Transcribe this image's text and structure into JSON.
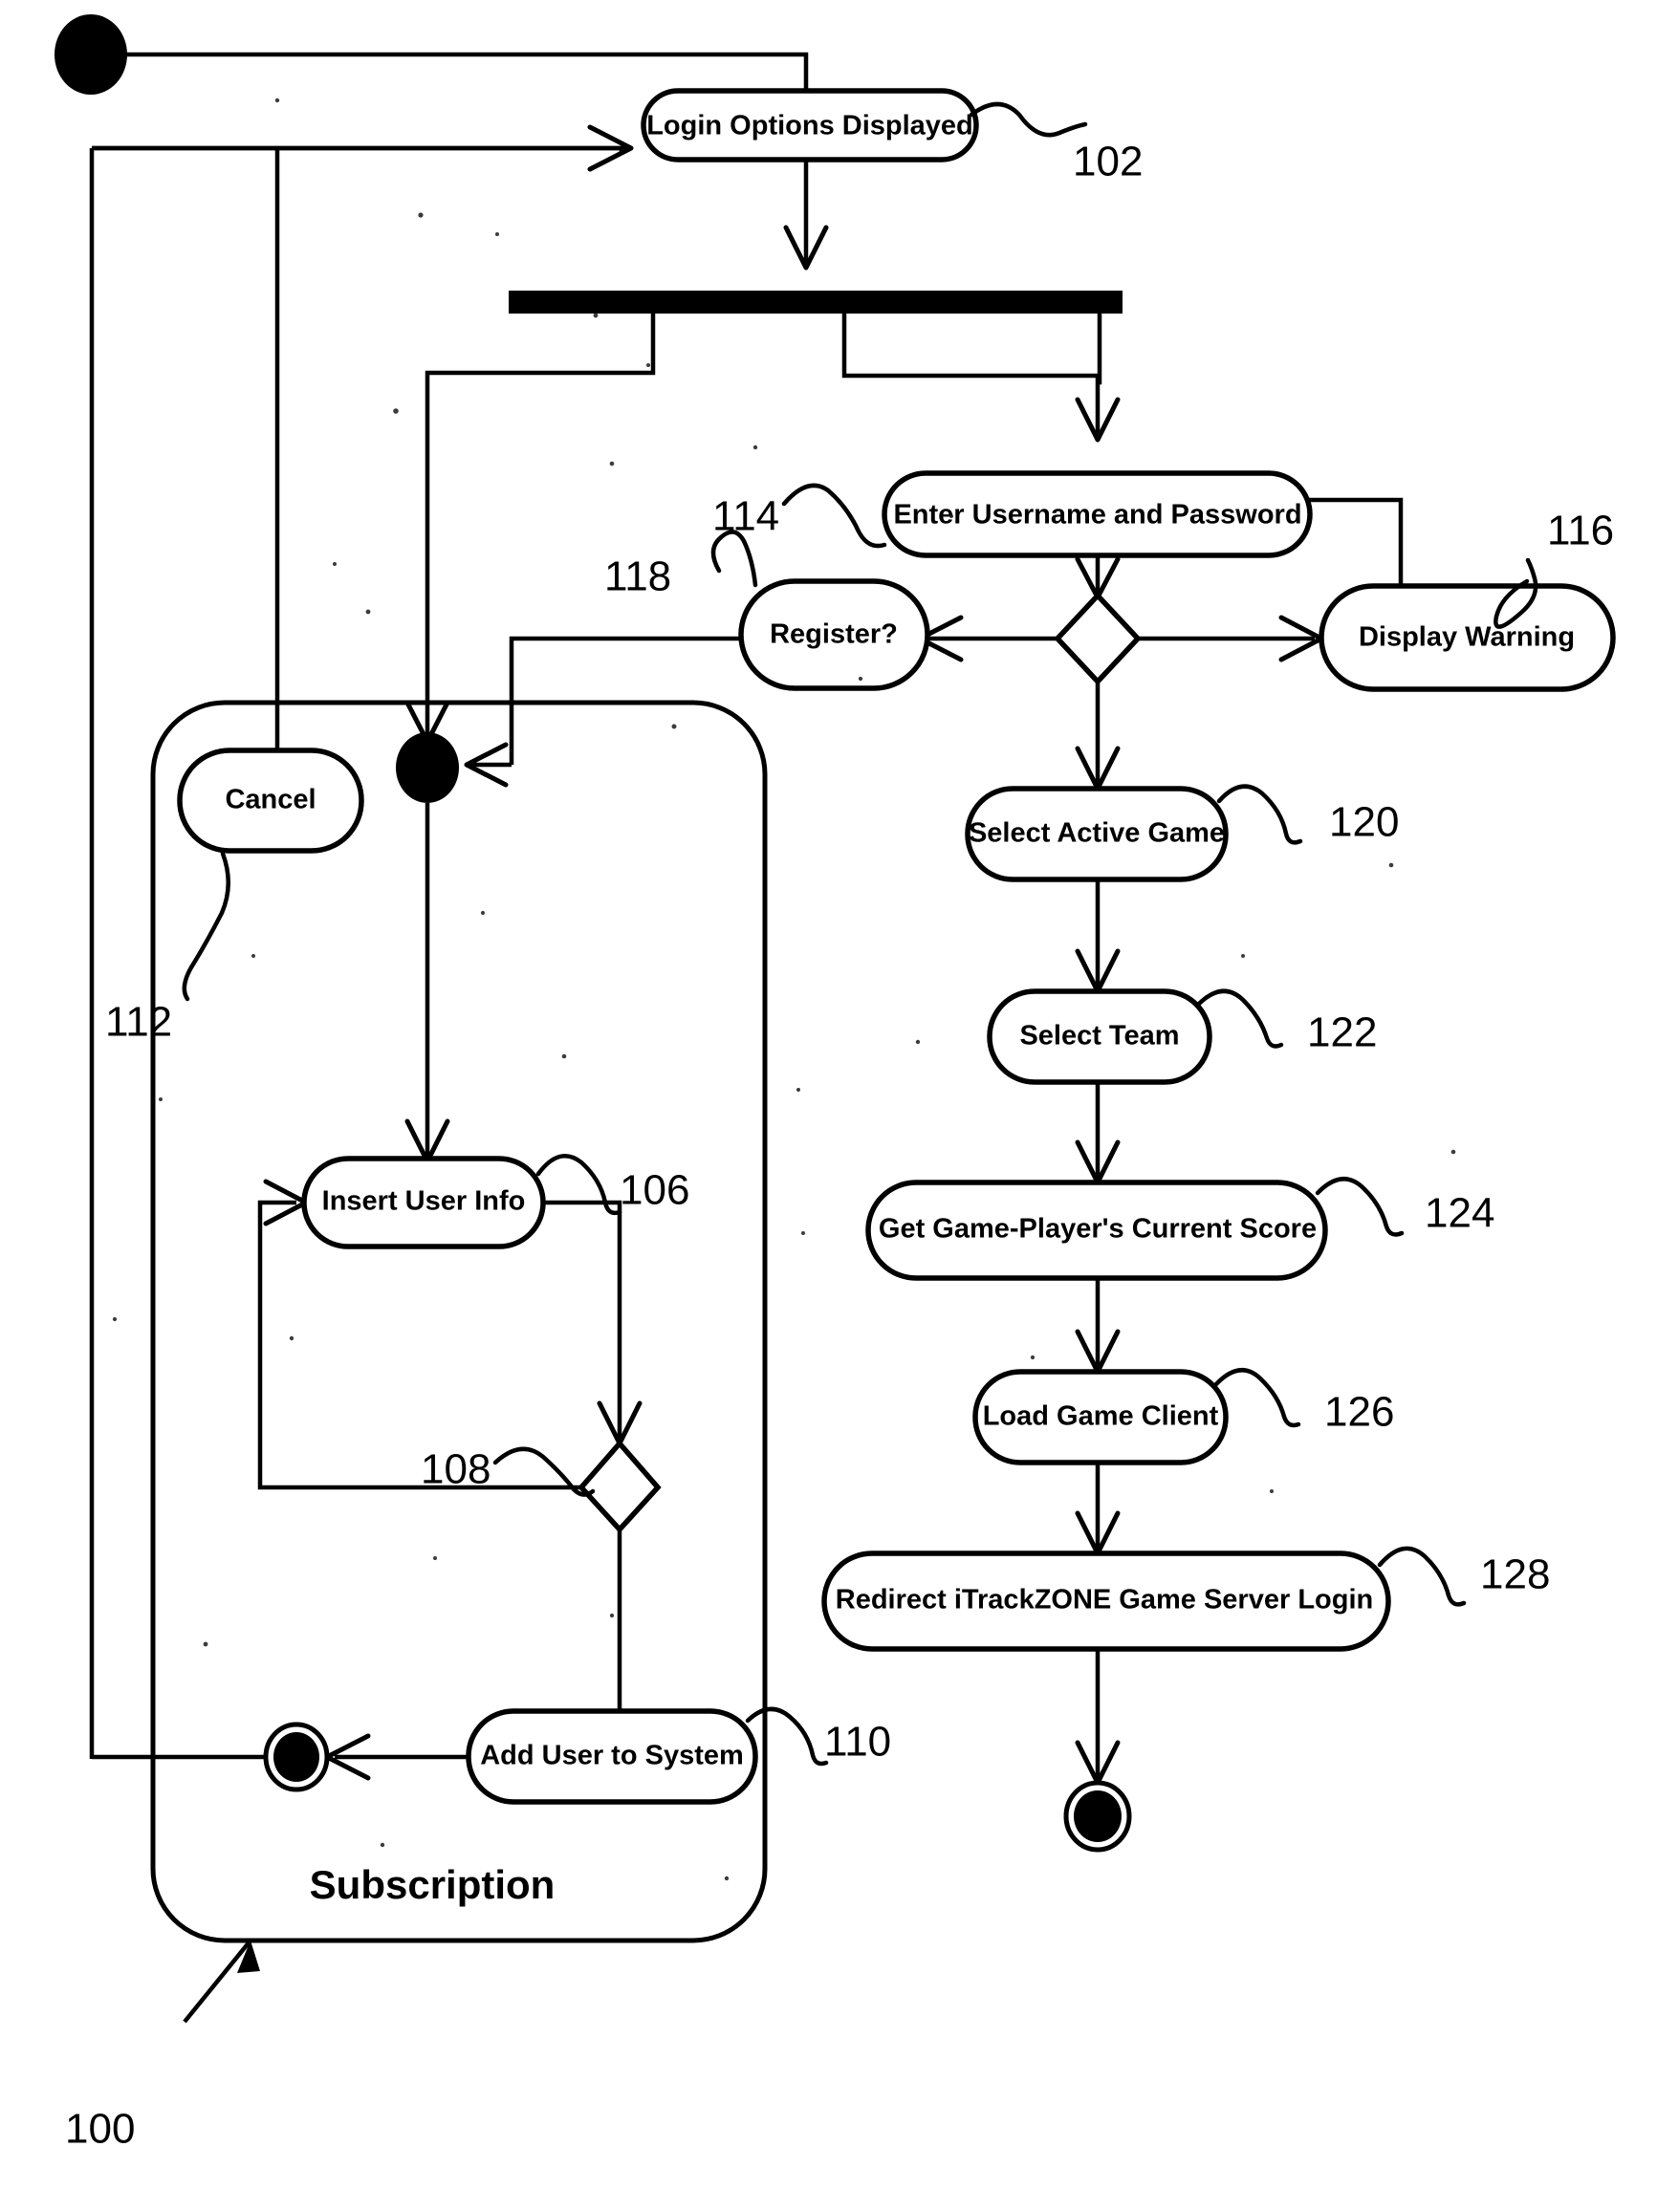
{
  "figure": {
    "figure_number": "100",
    "partition_label": "Subscription",
    "type": "uml-activity-diagram"
  },
  "nodes": [
    {
      "id": "start",
      "kind": "initial-state",
      "label": "",
      "ref": ""
    },
    {
      "id": "login_options",
      "kind": "action",
      "label": "Login Options Displayed",
      "ref": "102"
    },
    {
      "id": "fork",
      "kind": "fork-bar",
      "label": "",
      "ref": ""
    },
    {
      "id": "enter_creds",
      "kind": "action",
      "label": "Enter Username and Password",
      "ref": "114"
    },
    {
      "id": "display_warning",
      "kind": "action",
      "label": "Display Warning",
      "ref": "116"
    },
    {
      "id": "register",
      "kind": "action",
      "label": "Register?",
      "ref": "118"
    },
    {
      "id": "creds_decision",
      "kind": "decision",
      "label": "",
      "ref": ""
    },
    {
      "id": "sub_entry",
      "kind": "entry-state",
      "label": "",
      "ref": ""
    },
    {
      "id": "cancel",
      "kind": "action",
      "label": "Cancel",
      "ref": "112"
    },
    {
      "id": "insert_user",
      "kind": "action",
      "label": "Insert User Info",
      "ref": "106"
    },
    {
      "id": "insert_decision",
      "kind": "decision",
      "label": "",
      "ref": "108"
    },
    {
      "id": "add_user",
      "kind": "action",
      "label": "Add User to System",
      "ref": "110"
    },
    {
      "id": "sub_final",
      "kind": "final-state",
      "label": "",
      "ref": ""
    },
    {
      "id": "select_game",
      "kind": "action",
      "label": "Select Active Game",
      "ref": "120"
    },
    {
      "id": "select_team",
      "kind": "action",
      "label": "Select Team",
      "ref": "122"
    },
    {
      "id": "get_score",
      "kind": "action",
      "label": "Get Game-Player's Current Score",
      "ref": "124"
    },
    {
      "id": "load_client",
      "kind": "action",
      "label": "Load Game Client",
      "ref": "126"
    },
    {
      "id": "redirect_login",
      "kind": "action",
      "label": "Redirect iTrackZONE Game Server Login",
      "ref": "128"
    },
    {
      "id": "game_final",
      "kind": "final-state",
      "label": "",
      "ref": ""
    }
  ],
  "labels": {
    "n102": "102",
    "n106": "106",
    "n108": "108",
    "n110": "110",
    "n112": "112",
    "n114": "114",
    "n116": "116",
    "n118": "118",
    "n120": "120",
    "n122": "122",
    "n124": "124",
    "n126": "126",
    "n128": "128",
    "n100": "100"
  },
  "node_text": {
    "login_options": "Login Options Displayed",
    "enter_creds": "Enter Username and Password",
    "display_warning": "Display Warning",
    "register": "Register?",
    "cancel": "Cancel",
    "insert_user": "Insert User Info",
    "add_user": "Add User to System",
    "select_game": "Select Active Game",
    "select_team": "Select Team",
    "get_score": "Get Game-Player's Current Score",
    "load_client": "Load Game Client",
    "redirect_login": "Redirect iTrackZONE Game Server Login",
    "partition": "Subscription"
  },
  "colors": {
    "ink": "#000000",
    "paper": "#ffffff"
  }
}
